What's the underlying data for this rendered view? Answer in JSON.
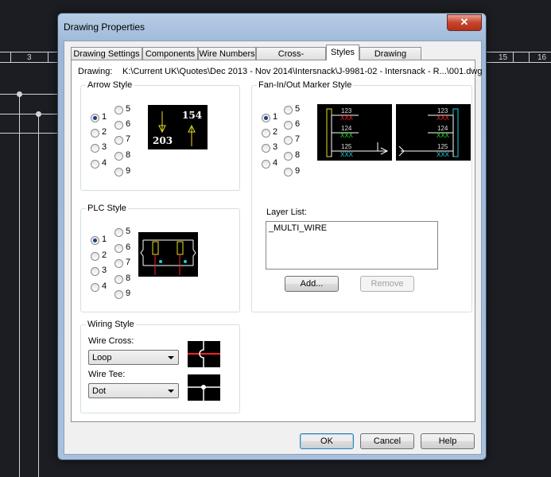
{
  "background": {
    "ruler_left": "3",
    "ruler_right": [
      "15",
      "16"
    ]
  },
  "dialog": {
    "title": "Drawing Properties",
    "close_label": "✕"
  },
  "tabs": [
    {
      "label": "Drawing Settings"
    },
    {
      "label": "Components"
    },
    {
      "label": "Wire Numbers"
    },
    {
      "label": "Cross-References"
    },
    {
      "label": "Styles"
    },
    {
      "label": "Drawing Format"
    }
  ],
  "drawing": {
    "label": "Drawing:",
    "path": "K:\\Current UK\\Quotes\\Dec 2013 - Nov 2014\\Intersnack\\J-9981-02 - Intersnack - R...\\001.dwg"
  },
  "arrow_style": {
    "title": "Arrow Style",
    "options": [
      "1",
      "2",
      "3",
      "4",
      "5",
      "6",
      "7",
      "8",
      "9"
    ],
    "selected": "1",
    "preview_top": "154",
    "preview_bottom": "203"
  },
  "fan_style": {
    "title": "Fan-In/Out Marker Style",
    "options": [
      "1",
      "2",
      "3",
      "4",
      "5",
      "6",
      "7",
      "8",
      "9"
    ],
    "selected": "1",
    "preview_numbers": [
      "123",
      "124",
      "125"
    ],
    "preview_placeholder": "XXX"
  },
  "plc_style": {
    "title": "PLC Style",
    "options": [
      "1",
      "2",
      "3",
      "4",
      "5",
      "6",
      "7",
      "8",
      "9"
    ],
    "selected": "1"
  },
  "layer_list": {
    "label": "Layer List:",
    "items": [
      "_MULTI_WIRE"
    ],
    "add_label": "Add...",
    "remove_label": "Remove"
  },
  "wiring_style": {
    "title": "Wiring Style",
    "wire_cross_label": "Wire Cross:",
    "wire_cross_value": "Loop",
    "wire_tee_label": "Wire Tee:",
    "wire_tee_value": "Dot"
  },
  "buttons": {
    "ok": "OK",
    "cancel": "Cancel",
    "help": "Help"
  },
  "colors": {
    "red": "#ff2020",
    "green": "#22dd22",
    "cyan": "#20d0e0",
    "yellow": "#e8e020"
  }
}
